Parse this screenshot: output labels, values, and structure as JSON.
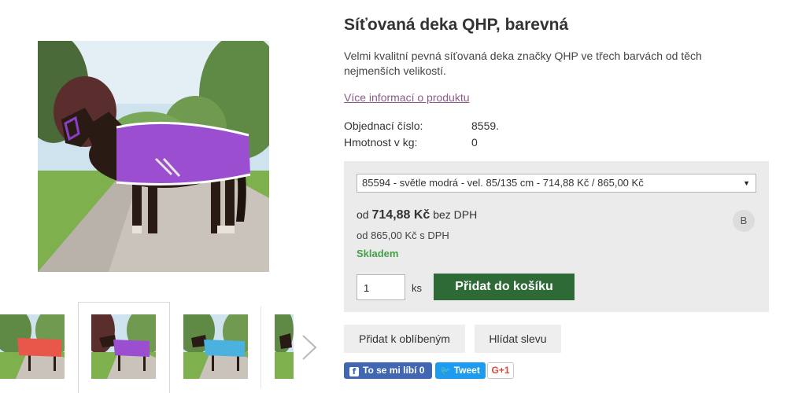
{
  "product": {
    "title": "Síťovaná deka QHP, barevná",
    "description": "Velmi kvalitní pevná síťovaná deka značky QHP ve třech barvách od těch nejmenších velikostí.",
    "more_info_link": "Více informací o produktu",
    "specs": [
      {
        "label": "Objednací číslo:",
        "value": "8559."
      },
      {
        "label": "Hmotnost v kg:",
        "value": "0"
      }
    ]
  },
  "gallery": {
    "main_image": "horse-purple-rug-photo",
    "thumbnails": [
      "horse-red-rug-photo",
      "horse-purple-rug-photo",
      "horse-blue-rug-photo",
      "horse-partial-photo"
    ],
    "next_icon": "chevron-right-icon"
  },
  "buy_box": {
    "variant_selected": "85594 - světle modrá - vel. 85/135 cm - 714,88 Kč / 865,00 Kč",
    "price_prefix": "od",
    "price_ex_vat": "714,88 Kč",
    "price_ex_vat_suffix": "bez DPH",
    "price_inc_vat": "od 865,00 Kč s DPH",
    "stock": "Skladem",
    "badge": "B",
    "quantity": "1",
    "quantity_unit": "ks",
    "add_to_cart": "Přidat do košíku"
  },
  "actions": {
    "favorite": "Přidat k oblíbeným",
    "watch_price": "Hlídat slevu"
  },
  "social": {
    "facebook": "To se mi líbí 0",
    "twitter": "Tweet",
    "gplus": "G+1"
  },
  "colors": {
    "cart_button": "#2d6a36",
    "stock_green": "#45a046",
    "link_purple": "#8a5a8a",
    "rug_purple": "#9b4fd0",
    "rug_red": "#e8574a",
    "rug_blue": "#4bb2e0"
  }
}
